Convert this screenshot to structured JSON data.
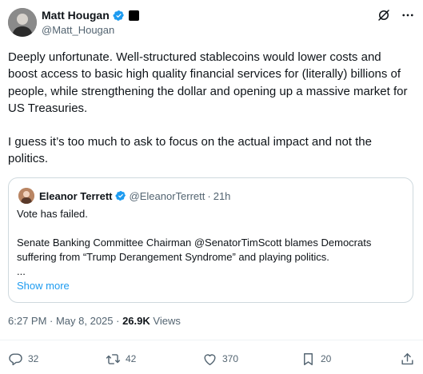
{
  "author": {
    "display_name": "Matt Hougan",
    "handle": "@Matt_Hougan"
  },
  "tweet": {
    "paragraphs": [
      "Deeply unfortunate.  Well-structured stablecoins would lower costs and boost access to basic high quality financial services for (literally) billions of people, while strengthening the dollar and opening up a massive market for US Treasuries.",
      "I guess it’s too much to ask to focus on the actual impact and not the politics."
    ]
  },
  "quote": {
    "display_name": "Eleanor Terrett",
    "handle": "@EleanorTerrett",
    "separator": "·",
    "time": "21h",
    "lines": [
      "Vote has failed.",
      "Senate Banking Committee Chairman @SenatorTimScott blames Democrats suffering from “Trump Derangement Syndrome” and playing politics.",
      "..."
    ],
    "show_more": "Show more"
  },
  "meta": {
    "timestamp": "6:27 PM · May 8, 2025 · ",
    "views_count": "26.9K",
    "views_label": " Views"
  },
  "actions": {
    "replies": "32",
    "retweets": "42",
    "likes": "370",
    "bookmarks": "20"
  },
  "colors": {
    "accent": "#1d9bf0",
    "text": "#0f1419",
    "secondary": "#536471",
    "border": "#cfd9de"
  },
  "icons": [
    "verified-badge-icon",
    "grok-icon",
    "more-icon",
    "reply-icon",
    "retweet-icon",
    "like-icon",
    "bookmark-icon",
    "share-icon"
  ]
}
